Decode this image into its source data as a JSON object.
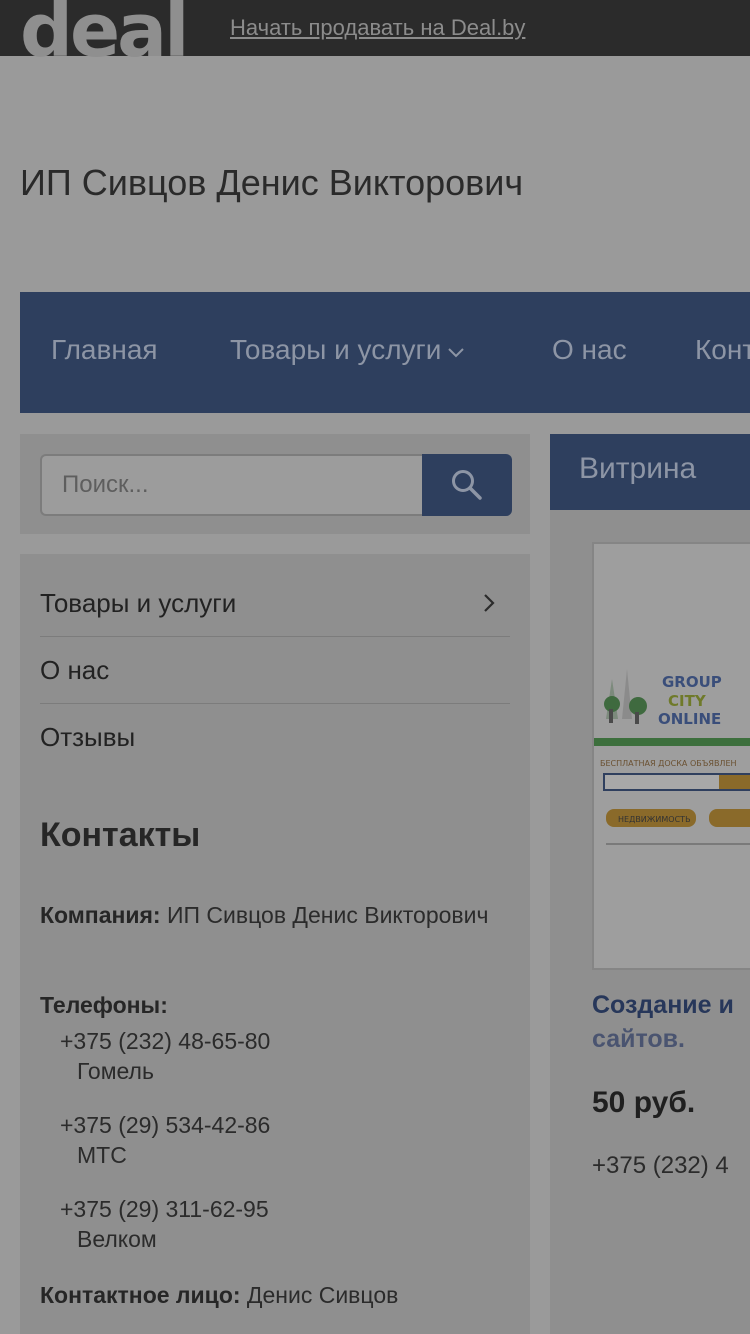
{
  "topbar": {
    "logo": "deal",
    "sell_link": "Начать продавать на Deal.by"
  },
  "company": {
    "title": "ИП Сивцов Денис Викторович"
  },
  "nav": {
    "items": [
      {
        "label": "Главная"
      },
      {
        "label": "Товары и услуги",
        "icon": "chevron-down-icon"
      },
      {
        "label": "О нас"
      },
      {
        "label": "Контакты"
      }
    ]
  },
  "search": {
    "placeholder": "Поиск...",
    "icon": "search-icon"
  },
  "sidebar": {
    "menu": [
      {
        "label": "Товары и услуги",
        "icon": "chevron-right-icon"
      },
      {
        "label": "О нас"
      },
      {
        "label": "Отзывы"
      }
    ],
    "contacts": {
      "title": "Контакты",
      "company_label": "Компания:",
      "company_value": "ИП Сивцов Денис Викторович",
      "phones_label": "Телефоны:",
      "phones": [
        {
          "number": "+375 (232) 48-65-80",
          "operator": "Гомель"
        },
        {
          "number": "+375 (29) 534-42-86",
          "operator": "МТС"
        },
        {
          "number": "+375 (29) 311-62-95",
          "operator": "Велком"
        }
      ],
      "person_label": "Контактное лицо:",
      "person_value": "Денис Сивцов"
    }
  },
  "vitrina": {
    "title": "Витрина",
    "product": {
      "image_text": [
        "GROUP",
        "CITY",
        "ONLINE",
        "БЕСПЛАТНАЯ ДОСКА ОБЪЯВЛЕН",
        "НЕДВИЖИМОСТЬ"
      ],
      "title_line1": "Создание и",
      "title_line2": "сайтов.",
      "price": "50 руб.",
      "phone": "+375 (232) 4"
    }
  },
  "colors": {
    "nav_background": "#2e3f5e",
    "topbar_background": "#2b2b2b",
    "link_title": "#27375a"
  }
}
